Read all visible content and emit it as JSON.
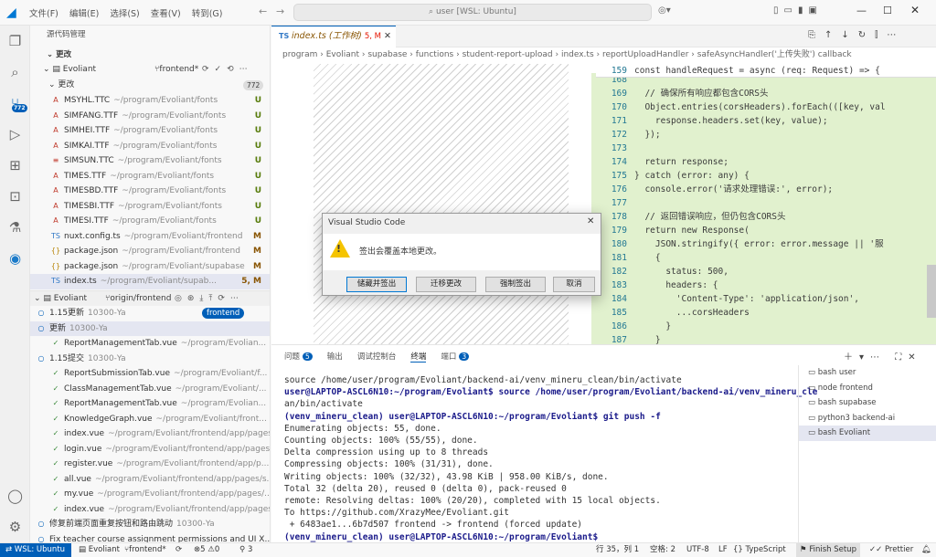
{
  "menu": [
    "文件(F)",
    "编辑(E)",
    "选择(S)",
    "查看(V)",
    "转到(G)"
  ],
  "search": {
    "text": "user [WSL: Ubuntu]"
  },
  "activity": {
    "badge": "772"
  },
  "sidebar": {
    "header": "源代码管理",
    "section": "更改",
    "repo": "Evoliant",
    "branch": "frontend*",
    "changes_label": "更改",
    "changes_count": "772",
    "files": [
      {
        "name": "MSYHL.TTC",
        "path": "~/program/Evoliant/fonts",
        "status": "U",
        "icon": "A"
      },
      {
        "name": "SIMFANG.TTF",
        "path": "~/program/Evoliant/fonts",
        "status": "U",
        "icon": "A"
      },
      {
        "name": "SIMHEI.TTF",
        "path": "~/program/Evoliant/fonts",
        "status": "U",
        "icon": "A"
      },
      {
        "name": "SIMKAI.TTF",
        "path": "~/program/Evoliant/fonts",
        "status": "U",
        "icon": "A"
      },
      {
        "name": "SIMSUN.TTC",
        "path": "~/program/Evoliant/fonts",
        "status": "U",
        "icon": "≡"
      },
      {
        "name": "TIMES.TTF",
        "path": "~/program/Evoliant/fonts",
        "status": "U",
        "icon": "A"
      },
      {
        "name": "TIMESBD.TTF",
        "path": "~/program/Evoliant/fonts",
        "status": "U",
        "icon": "A"
      },
      {
        "name": "TIMESBI.TTF",
        "path": "~/program/Evoliant/fonts",
        "status": "U",
        "icon": "A"
      },
      {
        "name": "TIMESI.TTF",
        "path": "~/program/Evoliant/fonts",
        "status": "U",
        "icon": "A"
      },
      {
        "name": "nuxt.config.ts",
        "path": "~/program/Evoliant/frontend",
        "status": "M",
        "icon": "TS"
      },
      {
        "name": "package.json",
        "path": "~/program/Evoliant/frontend",
        "status": "M",
        "icon": "{}"
      },
      {
        "name": "package.json",
        "path": "~/program/Evoliant/supabase",
        "status": "M",
        "icon": "{}"
      },
      {
        "name": "index.ts",
        "path": "~/program/Evoliant/supab...",
        "status": "5, M",
        "icon": "TS"
      }
    ],
    "graph_header": {
      "repo": "Evoliant",
      "remote": "origin/frontend"
    },
    "graph": [
      {
        "text": "1.15更新",
        "sub": "10300-Ya",
        "badge": "frontend"
      },
      {
        "text": "更新",
        "sub": "10300-Ya"
      },
      {
        "text": "ReportManagementTab.vue",
        "sub": "~/program/Evolian..."
      },
      {
        "text": "1.15提交",
        "sub": "10300-Ya"
      },
      {
        "text": "ReportSubmissionTab.vue",
        "sub": "~/program/Evoliant/f..."
      },
      {
        "text": "ClassManagementTab.vue",
        "sub": "~/program/Evoliant/..."
      },
      {
        "text": "ReportManagementTab.vue",
        "sub": "~/program/Evolian..."
      },
      {
        "text": "KnowledgeGraph.vue",
        "sub": "~/program/Evoliant/front..."
      },
      {
        "text": "index.vue",
        "sub": "~/program/Evoliant/frontend/app/pages"
      },
      {
        "text": "login.vue",
        "sub": "~/program/Evoliant/frontend/app/pages"
      },
      {
        "text": "register.vue",
        "sub": "~/program/Evoliant/frontend/app/p..."
      },
      {
        "text": "all.vue",
        "sub": "~/program/Evoliant/frontend/app/pages/s..."
      },
      {
        "text": "my.vue",
        "sub": "~/program/Evoliant/frontend/app/pages/..."
      },
      {
        "text": "index.vue",
        "sub": "~/program/Evoliant/frontend/app/pages/..."
      },
      {
        "text": "修复前端页面重复按钮和路由跳动",
        "sub": "10300-Ya"
      },
      {
        "text": "Fix teacher course assignment permissions and UI X...",
        "sub": ""
      }
    ]
  },
  "editor": {
    "tab": "index.ts (工作树)",
    "tab_status": "5, M",
    "breadcrumb": [
      "program",
      "Evoliant",
      "supabase",
      "functions",
      "student-report-upload",
      "index.ts",
      "reportUploadHandler",
      "safeAsyncHandler('上传失败') callback"
    ],
    "sticky": {
      "num": "159",
      "text": "const handleRequest = async (req: Request) => {"
    },
    "lines": [
      {
        "num": "168",
        "text": ""
      },
      {
        "num": "169",
        "text": "  // 确保所有响应都包含CORS头"
      },
      {
        "num": "170",
        "text": "  Object.entries(corsHeaders).forEach(([key, val"
      },
      {
        "num": "171",
        "text": "    response.headers.set(key, value);"
      },
      {
        "num": "172",
        "text": "  });"
      },
      {
        "num": "173",
        "text": ""
      },
      {
        "num": "174",
        "text": "  return response;"
      },
      {
        "num": "175",
        "text": "} catch (error: any) {"
      },
      {
        "num": "176",
        "text": "  console.error('请求处理错误:', error);"
      },
      {
        "num": "177",
        "text": ""
      },
      {
        "num": "178",
        "text": "  // 返回错误响应，但仍包含CORS头"
      },
      {
        "num": "179",
        "text": "  return new Response("
      },
      {
        "num": "180",
        "text": "    JSON.stringify({ error: error.message || '服"
      },
      {
        "num": "181",
        "text": "    {"
      },
      {
        "num": "182",
        "text": "      status: 500,"
      },
      {
        "num": "183",
        "text": "      headers: {"
      },
      {
        "num": "184",
        "text": "        'Content-Type': 'application/json',"
      },
      {
        "num": "185",
        "text": "        ...corsHeaders"
      },
      {
        "num": "186",
        "text": "      }"
      },
      {
        "num": "187",
        "text": "    }"
      }
    ]
  },
  "dialog": {
    "title": "Visual Studio Code",
    "message": "签出会覆盖本地更改。",
    "buttons": [
      "储藏并签出",
      "迁移更改",
      "强制签出",
      "取消"
    ]
  },
  "panel": {
    "tabs": [
      {
        "label": "问题",
        "badge": "5"
      },
      {
        "label": "输出"
      },
      {
        "label": "调试控制台"
      },
      {
        "label": "终端"
      },
      {
        "label": "端口",
        "badge": "3"
      }
    ],
    "terminal": [
      "source /home/user/program/Evoliant/backend-ai/venv_mineru_clean/bin/activate",
      "user@LAPTOP-ASCL6N10:~/program/Evoliant$ source /home/user/program/Evoliant/backend-ai/venv_mineru_cle",
      "an/bin/activate",
      "(venv_mineru_clean) user@LAPTOP-ASCL6N10:~/program/Evoliant$ git push -f",
      "Enumerating objects: 55, done.",
      "Counting objects: 100% (55/55), done.",
      "Delta compression using up to 8 threads",
      "Compressing objects: 100% (31/31), done.",
      "Writing objects: 100% (32/32), 43.98 KiB | 958.00 KiB/s, done.",
      "Total 32 (delta 20), reused 0 (delta 0), pack-reused 0",
      "remote: Resolving deltas: 100% (20/20), completed with 15 local objects.",
      "To https://github.com/XrazyMee/Evoliant.git",
      " + 6483ae1...6b7d507 frontend -> frontend (forced update)",
      "(venv_mineru_clean) user@LAPTOP-ASCL6N10:~/program/Evoliant$ "
    ],
    "terminals": [
      "bash user",
      "node frontend",
      "bash supabase",
      "python3 backend-ai",
      "bash Evoliant"
    ]
  },
  "status": {
    "remote": "WSL: Ubuntu",
    "repo": "Evoliant",
    "branch": "frontend*",
    "errors": "⊗5",
    "warnings": "⚠0",
    "ports": "3",
    "position": "行 35，列 1",
    "spaces": "空格: 2",
    "encoding": "UTF-8",
    "eol": "LF",
    "language": "TypeScript",
    "finish": "Finish Setup",
    "prettier": "Prettier"
  }
}
